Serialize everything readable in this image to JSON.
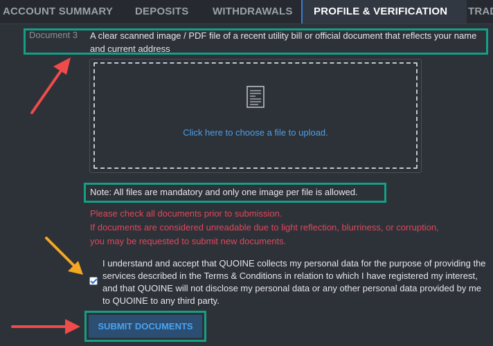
{
  "tabs": [
    {
      "label": "ACCOUNT SUMMARY"
    },
    {
      "label": "DEPOSITS"
    },
    {
      "label": "WITHDRAWALS"
    },
    {
      "label": "PROFILE & VERIFICATION",
      "active": true
    },
    {
      "label": "TRAD"
    }
  ],
  "document": {
    "label": "Document 3",
    "description": "A clear scanned image / PDF file of a recent utility bill or official document that reflects your name and current address"
  },
  "upload": {
    "link_text": "Click here to choose a file to upload.",
    "icon": "document-icon"
  },
  "note": "Note: All files are mandatory and only one image per file is allowed.",
  "warnings": [
    "Please check all documents prior to submission.",
    "If documents are considered unreadable due to light reflection, blurriness, or corruption,",
    "you may be requested to submit new documents."
  ],
  "consent": {
    "checked": true,
    "text": "I understand and accept that QUOINE collects my personal data for the purpose of providing the services described in the Terms & Conditions in relation to which I have registered my interest, and that QUOINE will not disclose my personal data or any other personal data provided by me to QUOINE to any third party."
  },
  "submit_label": "SUBMIT DOCUMENTS",
  "colors": {
    "background": "#2d3138",
    "highlight_box": "#14a085",
    "warning_text": "#e0485a",
    "link": "#4b9fe8",
    "arrow_red": "#ef4b4b",
    "arrow_orange": "#f5a623"
  }
}
